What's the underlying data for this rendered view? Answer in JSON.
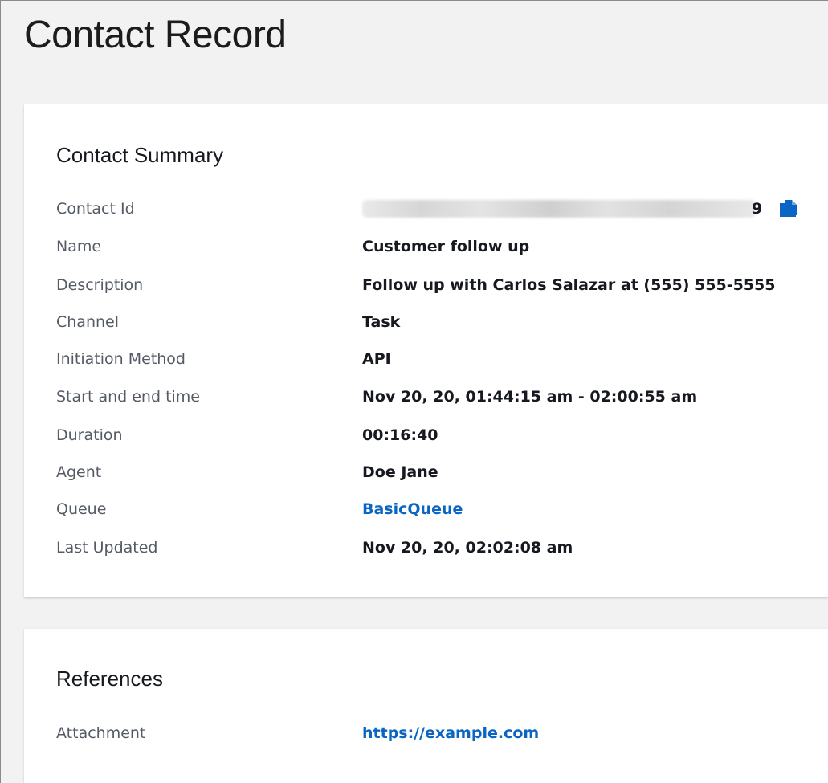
{
  "page": {
    "title": "Contact Record"
  },
  "summary": {
    "title": "Contact Summary",
    "contact_id": {
      "label": "Contact Id",
      "visible_tail": "9",
      "copy_icon": "copy-icon"
    },
    "fields": [
      {
        "label": "Name",
        "value": "Customer follow up"
      },
      {
        "label": "Description",
        "value": "Follow up with Carlos Salazar at (555) 555-5555"
      },
      {
        "label": "Channel",
        "value": "Task"
      },
      {
        "label": "Initiation Method",
        "value": "API"
      },
      {
        "label": "Start and end time",
        "value": "Nov 20, 20, 01:44:15 am - 02:00:55 am"
      },
      {
        "label": "Duration",
        "value": "00:16:40"
      },
      {
        "label": "Agent",
        "value": "Doe Jane"
      },
      {
        "label": "Queue",
        "value": "BasicQueue"
      },
      {
        "label": "Last Updated",
        "value": "Nov 20, 20, 02:02:08 am"
      }
    ]
  },
  "references": {
    "title": "References",
    "attachment": {
      "label": "Attachment",
      "value": "https://example.com"
    }
  },
  "colors": {
    "page_background": "#f2f2f2",
    "card_background": "#ffffff",
    "label_text": "#545b64",
    "value_text": "#16191f",
    "link": "#0a66c2",
    "icon": "#0a66c2"
  }
}
